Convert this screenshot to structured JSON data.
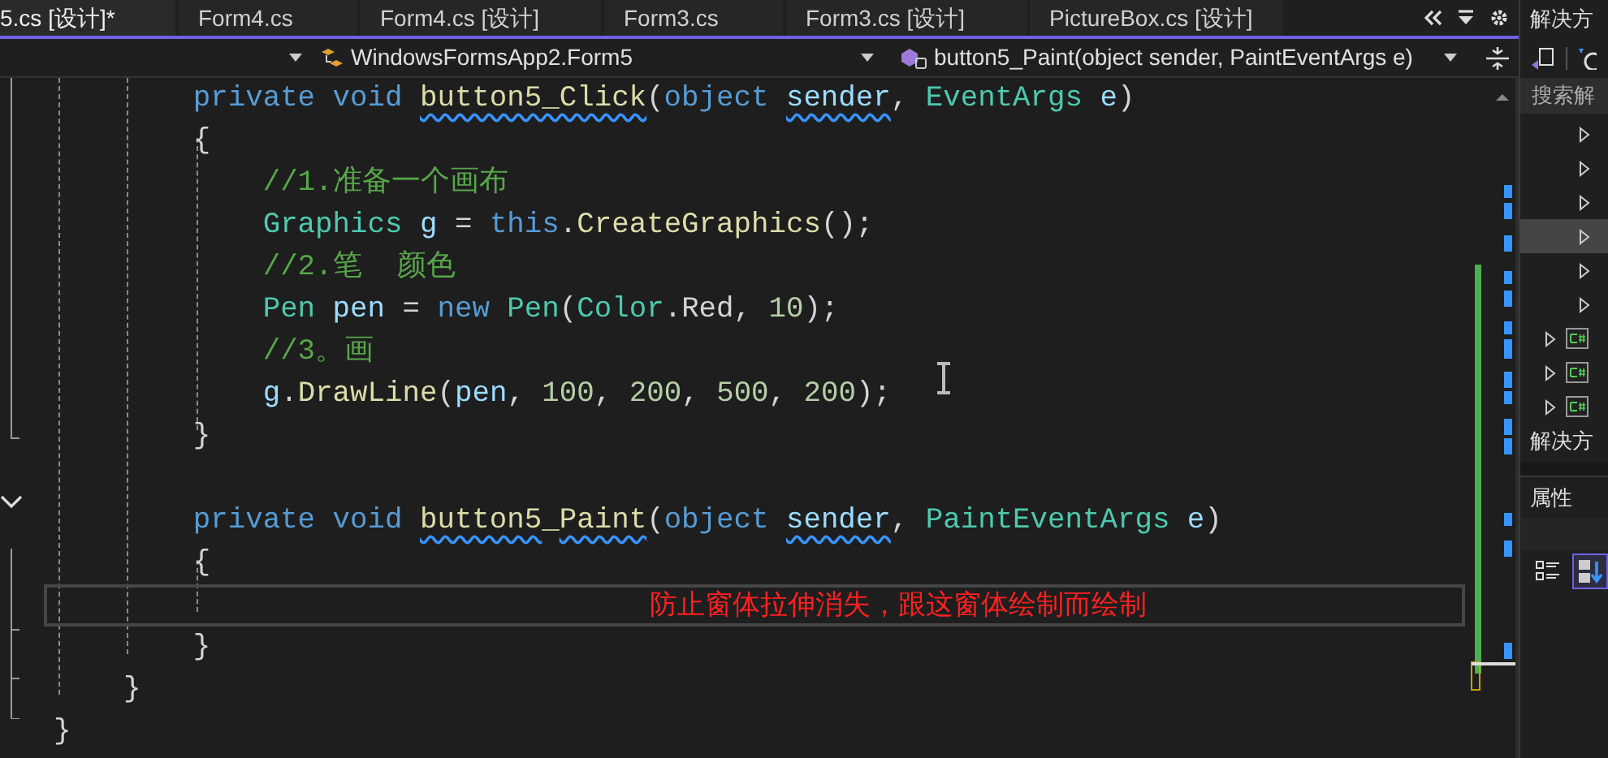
{
  "tabs": [
    {
      "label": "5.cs [设计]*",
      "selected": true
    },
    {
      "label": "Form4.cs",
      "selected": false
    },
    {
      "label": "Form4.cs [设计]",
      "selected": false
    },
    {
      "label": "Form3.cs",
      "selected": false
    },
    {
      "label": "Form3.cs [设计]",
      "selected": false
    },
    {
      "label": "PictureBox.cs [设计]",
      "selected": false
    }
  ],
  "navigation_bar": {
    "type": "WindowsFormsApp2.Form5",
    "member": "button5_Paint(object sender, PaintEventArgs e)"
  },
  "editor": {
    "lines": [
      {
        "tokens": [
          {
            "text": "        private void ",
            "kind": "keyword"
          },
          {
            "text": "button5_Click",
            "kind": "method",
            "squiggle": true
          },
          {
            "text": "(",
            "kind": "plain"
          },
          {
            "text": "object ",
            "kind": "keyword"
          },
          {
            "text": "sender",
            "kind": "param",
            "squiggle": true
          },
          {
            "text": ", ",
            "kind": "plain"
          },
          {
            "text": "EventArgs ",
            "kind": "type"
          },
          {
            "text": "e",
            "kind": "param"
          },
          {
            "text": ")",
            "kind": "plain"
          }
        ]
      },
      {
        "tokens": [
          {
            "text": "        {",
            "kind": "plain"
          }
        ]
      },
      {
        "tokens": [
          {
            "text": "            //1.准备一个画布",
            "kind": "comment"
          }
        ]
      },
      {
        "tokens": [
          {
            "text": "            Graphics ",
            "kind": "type"
          },
          {
            "text": "g",
            "kind": "param"
          },
          {
            "text": " = ",
            "kind": "plain"
          },
          {
            "text": "this",
            "kind": "keyword"
          },
          {
            "text": ".",
            "kind": "plain"
          },
          {
            "text": "CreateGraphics",
            "kind": "method"
          },
          {
            "text": "();",
            "kind": "plain"
          }
        ]
      },
      {
        "tokens": [
          {
            "text": "            //2.笔  颜色",
            "kind": "comment"
          }
        ]
      },
      {
        "tokens": [
          {
            "text": "            Pen ",
            "kind": "type"
          },
          {
            "text": "pen",
            "kind": "param"
          },
          {
            "text": " = ",
            "kind": "plain"
          },
          {
            "text": "new ",
            "kind": "keyword"
          },
          {
            "text": "Pen",
            "kind": "type"
          },
          {
            "text": "(",
            "kind": "plain"
          },
          {
            "text": "Color",
            "kind": "type"
          },
          {
            "text": ".Red, ",
            "kind": "plain"
          },
          {
            "text": "10",
            "kind": "number"
          },
          {
            "text": ");",
            "kind": "plain"
          }
        ]
      },
      {
        "tokens": [
          {
            "text": "            //3。画",
            "kind": "comment"
          }
        ]
      },
      {
        "tokens": [
          {
            "text": "            g",
            "kind": "param"
          },
          {
            "text": ".",
            "kind": "plain"
          },
          {
            "text": "DrawLine",
            "kind": "method"
          },
          {
            "text": "(",
            "kind": "plain"
          },
          {
            "text": "pen",
            "kind": "param"
          },
          {
            "text": ", ",
            "kind": "plain"
          },
          {
            "text": "100",
            "kind": "number"
          },
          {
            "text": ", ",
            "kind": "plain"
          },
          {
            "text": "200",
            "kind": "number"
          },
          {
            "text": ", ",
            "kind": "plain"
          },
          {
            "text": "500",
            "kind": "number"
          },
          {
            "text": ", ",
            "kind": "plain"
          },
          {
            "text": "200",
            "kind": "number"
          },
          {
            "text": ");",
            "kind": "plain"
          }
        ]
      },
      {
        "tokens": [
          {
            "text": "        }",
            "kind": "plain"
          }
        ]
      },
      {
        "current": false
      },
      {
        "tokens": [
          {
            "text": "        private void ",
            "kind": "keyword"
          },
          {
            "text": "button5",
            "kind": "method",
            "squiggle": true
          },
          {
            "text": "_",
            "kind": "method"
          },
          {
            "text": "Paint",
            "kind": "method",
            "squiggle": true
          },
          {
            "text": "(",
            "kind": "plain"
          },
          {
            "text": "object ",
            "kind": "keyword"
          },
          {
            "text": "sender",
            "kind": "param",
            "squiggle": true
          },
          {
            "text": ", ",
            "kind": "plain"
          },
          {
            "text": "PaintEventArgs ",
            "kind": "type"
          },
          {
            "text": "e",
            "kind": "param"
          },
          {
            "text": ")",
            "kind": "plain"
          }
        ]
      },
      {
        "tokens": [
          {
            "text": "        {",
            "kind": "plain"
          }
        ]
      },
      {
        "current": true
      },
      {
        "tokens": [
          {
            "text": "        }",
            "kind": "plain"
          }
        ]
      },
      {
        "tokens": [
          {
            "text": "    }",
            "kind": "plain"
          }
        ]
      },
      {
        "tokens": [
          {
            "text": "}",
            "kind": "plain"
          }
        ]
      }
    ],
    "annotation": "防止窗体拉伸消失，跟这窗体绘制而绘制"
  },
  "solution_explorer": {
    "title": "解决方",
    "search_placeholder": "搜索解",
    "items": [
      {
        "kind": "child",
        "selected": false
      },
      {
        "kind": "child",
        "selected": false
      },
      {
        "kind": "child",
        "selected": false
      },
      {
        "kind": "child",
        "selected": true
      },
      {
        "kind": "child",
        "selected": false
      },
      {
        "kind": "child",
        "selected": false
      },
      {
        "kind": "csharp-file",
        "selected": false
      },
      {
        "kind": "csharp-file",
        "selected": false
      },
      {
        "kind": "csharp-file",
        "selected": false
      }
    ],
    "footer_tab": "解决方"
  },
  "properties": {
    "title": "属性",
    "sort_buttons": [
      {
        "kind": "categorized",
        "selected": false
      },
      {
        "kind": "alphabetical",
        "selected": true
      }
    ]
  }
}
